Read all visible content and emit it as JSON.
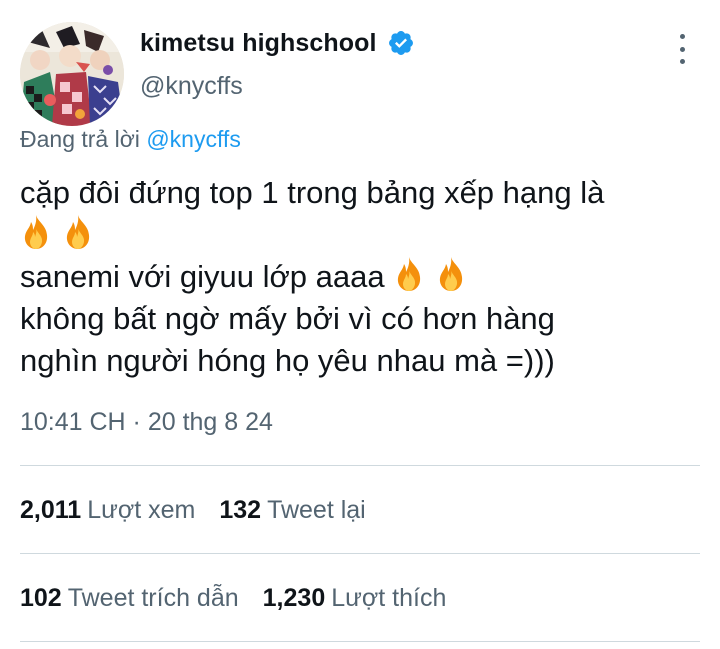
{
  "author": {
    "display_name": "kimetsu highschool",
    "handle": "@knycffs",
    "verified": true
  },
  "reply": {
    "prefix": "Đang trả lời",
    "mention": "@knycffs"
  },
  "tweet": {
    "lines": [
      "cặp đôi đứng top 1 trong bảng xếp hạng là",
      "",
      "sanemi với giyuu lớp aaaa",
      "không bất ngờ mấy bởi vì có hơn hàng",
      "nghìn người hóng họ yêu nhau mà =)))"
    ],
    "emoji": "fire"
  },
  "timestamp": "10:41 CH · 20 thg 8 24",
  "stats": {
    "views_count": "2,011",
    "views_label": "Lượt xem",
    "retweets_count": "132",
    "retweets_label": "Tweet lại",
    "quotes_count": "102",
    "quotes_label": "Tweet trích dẫn",
    "likes_count": "1,230",
    "likes_label": "Lượt thích"
  },
  "colors": {
    "accent": "#1d9bf0",
    "secondary_text": "#536471",
    "primary_text": "#0f1419",
    "divider": "#cfd9de"
  },
  "icons": {
    "verified": "verified-badge-icon",
    "more": "more-vertical-icon",
    "emoji": "fire-emoji-icon"
  }
}
